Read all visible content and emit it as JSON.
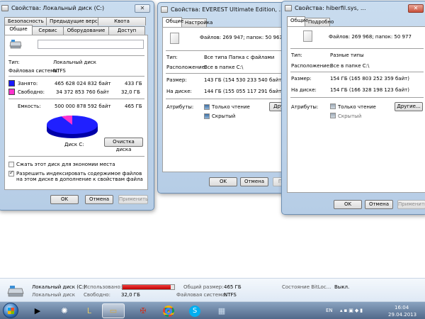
{
  "win_c": {
    "title": "Свойства: Локальный диск (C:)",
    "tabs_row1": [
      "Безопасность",
      "Предыдущие версии",
      "Квота"
    ],
    "tabs_row2": [
      "Общие",
      "Сервис",
      "Оборудование",
      "Доступ"
    ],
    "type_label": "Тип:",
    "type_value": "Локальный диск",
    "fs_label": "Файловая система:",
    "fs_value": "NTFS",
    "used_label": "Занято:",
    "used_bytes": "465 628 024 832 байт",
    "used_gb": "433 ГБ",
    "free_label": "Свободно:",
    "free_bytes": "34 372 853 760 байт",
    "free_gb": "32,0 ГБ",
    "cap_label": "Емкость:",
    "cap_bytes": "500 000 878 592 байт",
    "cap_gb": "465 ГБ",
    "disk_label": "Диск C:",
    "cleanup_button": "Очистка диска",
    "compress_label": "Сжать этот диск для экономии места",
    "index_label": "Разрешить индексировать содержимое файлов на этом диске в дополнение к свойствам файла",
    "ok": "OK",
    "cancel": "Отмена",
    "apply": "Применить",
    "colors": {
      "used": "#1a1aff",
      "free": "#ff33cc"
    },
    "pie": {
      "used_fraction": 0.93,
      "free_fraction": 0.07
    }
  },
  "win_everest": {
    "title": "Свойства: EVEREST Ultimate Edition, ...",
    "tabs": [
      "Общие",
      "Настройка"
    ],
    "files_line": "Файлов: 269 947; папок: 50 963",
    "type_label": "Тип:",
    "type_value": "Все типа Папка с файлами",
    "loc_label": "Расположение:",
    "loc_value": "Все в папке C:\\",
    "size_label": "Размер:",
    "size_value": "143 ГБ (154 530 233 540 байт)",
    "disk_label": "На диске:",
    "disk_value": "144 ГБ (155 055 117 291 байт)",
    "attr_label": "Атрибуты:",
    "readonly_label": "Только чтение",
    "hidden_label": "Скрытый",
    "other_button": "Друг",
    "ok": "OK",
    "cancel": "Отмена",
    "apply": "При"
  },
  "win_hiber": {
    "title": "Свойства: hiberfil.sys, ...",
    "tabs": [
      "Общие",
      "Подробно"
    ],
    "files_line": "Файлов: 269 968; папок: 50 977",
    "type_label": "Тип:",
    "type_value": "Разные типы",
    "loc_label": "Расположение:",
    "loc_value": "Все в папке C:\\",
    "size_label": "Размер:",
    "size_value": "154 ГБ (165 803 252 359 байт)",
    "disk_label": "На диске:",
    "disk_value": "154 ГБ (166 328 198 123 байт)",
    "attr_label": "Атрибуты:",
    "readonly_label": "Только чтение",
    "hidden_label": "Скрытый",
    "other_button": "Другие...",
    "ok": "OK",
    "cancel": "Отмена",
    "apply": "Применить"
  },
  "details": {
    "name": "Локальный диск (C:)",
    "type": "Локальный диск",
    "used_label": "Использовано:",
    "free_label": "Свободно:",
    "free_value": "32,0 ГБ",
    "total_label": "Общий размер:",
    "total_value": "465 ГБ",
    "fs_label": "Файловая система:",
    "fs_value": "NTFS",
    "bitlocker_label": "Состояние BitLoc...",
    "bitlocker_value": "Выкл.",
    "used_fraction": 0.93
  },
  "taskbar": {
    "lang": "EN",
    "time": "16:04",
    "date": "29.04.2013",
    "apps": [
      "media-player-icon",
      "pinball-icon",
      "game-icon",
      "explorer-icon",
      "game2-icon",
      "chrome-icon",
      "skype-icon",
      "network-icon"
    ]
  }
}
